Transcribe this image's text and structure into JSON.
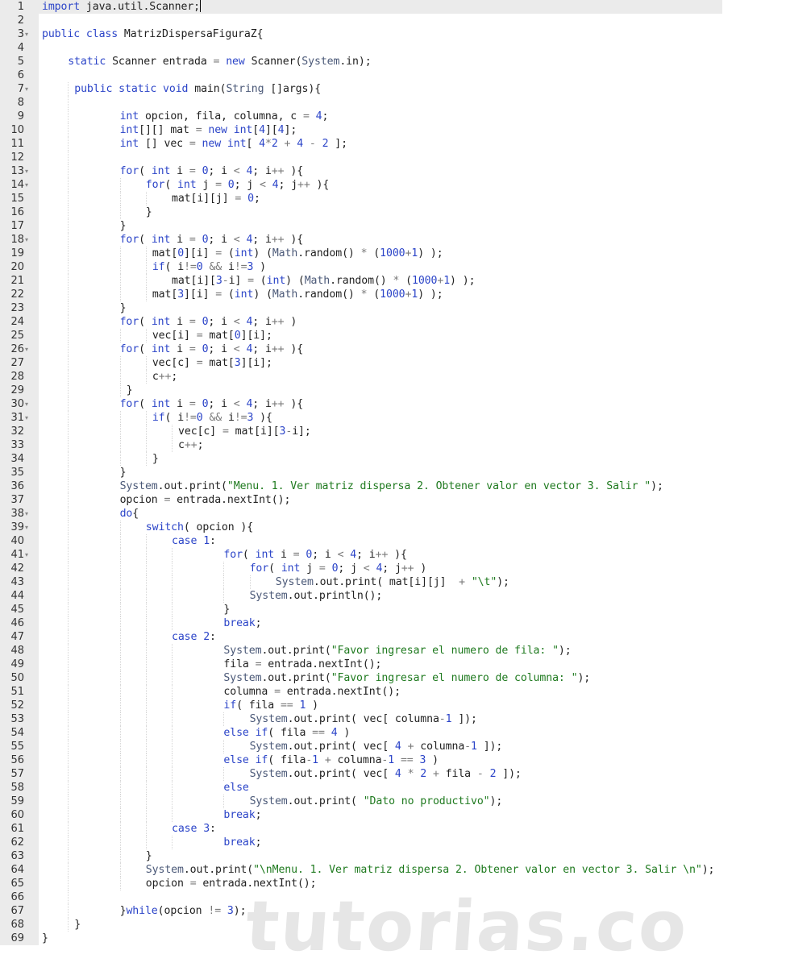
{
  "editor": {
    "language": "java",
    "active_line": 1,
    "cursor_line": 1,
    "lines": [
      {
        "n": "1",
        "indent": 0,
        "text": "import java.util.Scanner;"
      },
      {
        "n": "2",
        "indent": 0,
        "text": ""
      },
      {
        "n": "3",
        "indent": 0,
        "fold": true,
        "text": "public class MatrizDispersaFiguraZ{"
      },
      {
        "n": "4",
        "indent": 0,
        "text": ""
      },
      {
        "n": "5",
        "indent": 4,
        "text": "static Scanner entrada = new Scanner(System.in);"
      },
      {
        "n": "6",
        "indent": 0,
        "text": ""
      },
      {
        "n": "7",
        "indent": 5,
        "fold": true,
        "text": "public static void main(String []args){"
      },
      {
        "n": "8",
        "indent": 0,
        "text": ""
      },
      {
        "n": "9",
        "indent": 12,
        "text": "int opcion, fila, columna, c = 4;"
      },
      {
        "n": "10",
        "indent": 12,
        "text": "int[][] mat = new int[4][4];"
      },
      {
        "n": "11",
        "indent": 12,
        "text": "int [] vec = new int[ 4*2 + 4 - 2 ];"
      },
      {
        "n": "12",
        "indent": 0,
        "text": ""
      },
      {
        "n": "13",
        "indent": 12,
        "fold": true,
        "text": "for( int i = 0; i < 4; i++ ){"
      },
      {
        "n": "14",
        "indent": 16,
        "fold": true,
        "text": "for( int j = 0; j < 4; j++ ){"
      },
      {
        "n": "15",
        "indent": 20,
        "text": "mat[i][j] = 0;"
      },
      {
        "n": "16",
        "indent": 16,
        "text": "}"
      },
      {
        "n": "17",
        "indent": 12,
        "text": "}"
      },
      {
        "n": "18",
        "indent": 12,
        "fold": true,
        "text": "for( int i = 0; i < 4; i++ ){"
      },
      {
        "n": "19",
        "indent": 17,
        "text": "mat[0][i] = (int) (Math.random() * (1000+1) );"
      },
      {
        "n": "20",
        "indent": 17,
        "text": "if( i!=0 && i!=3 )"
      },
      {
        "n": "21",
        "indent": 20,
        "text": "mat[i][3-i] = (int) (Math.random() * (1000+1) );"
      },
      {
        "n": "22",
        "indent": 17,
        "text": "mat[3][i] = (int) (Math.random() * (1000+1) );"
      },
      {
        "n": "23",
        "indent": 12,
        "text": "}"
      },
      {
        "n": "24",
        "indent": 12,
        "text": "for( int i = 0; i < 4; i++ )"
      },
      {
        "n": "25",
        "indent": 17,
        "text": "vec[i] = mat[0][i];"
      },
      {
        "n": "26",
        "indent": 12,
        "fold": true,
        "text": "for( int i = 0; i < 4; i++ ){"
      },
      {
        "n": "27",
        "indent": 17,
        "text": "vec[c] = mat[3][i];"
      },
      {
        "n": "28",
        "indent": 17,
        "text": "c++;"
      },
      {
        "n": "29",
        "indent": 13,
        "text": "}"
      },
      {
        "n": "30",
        "indent": 12,
        "fold": true,
        "text": "for( int i = 0; i < 4; i++ ){"
      },
      {
        "n": "31",
        "indent": 17,
        "fold": true,
        "text": "if( i!=0 && i!=3 ){"
      },
      {
        "n": "32",
        "indent": 21,
        "text": "vec[c] = mat[i][3-i];"
      },
      {
        "n": "33",
        "indent": 21,
        "text": "c++;"
      },
      {
        "n": "34",
        "indent": 17,
        "text": "}"
      },
      {
        "n": "35",
        "indent": 12,
        "text": "}"
      },
      {
        "n": "36",
        "indent": 12,
        "text": "System.out.print(\"Menu. 1. Ver matriz dispersa 2. Obtener valor en vector 3. Salir \");"
      },
      {
        "n": "37",
        "indent": 12,
        "text": "opcion = entrada.nextInt();"
      },
      {
        "n": "38",
        "indent": 12,
        "fold": true,
        "text": "do{"
      },
      {
        "n": "39",
        "indent": 16,
        "fold": true,
        "text": "switch( opcion ){"
      },
      {
        "n": "40",
        "indent": 20,
        "text": "case 1:"
      },
      {
        "n": "41",
        "indent": 28,
        "fold": true,
        "text": "for( int i = 0; i < 4; i++ ){"
      },
      {
        "n": "42",
        "indent": 32,
        "text": "for( int j = 0; j < 4; j++ )"
      },
      {
        "n": "43",
        "indent": 36,
        "text": "System.out.print( mat[i][j]  + \"\\t\");"
      },
      {
        "n": "44",
        "indent": 32,
        "text": "System.out.println();"
      },
      {
        "n": "45",
        "indent": 28,
        "text": "}"
      },
      {
        "n": "46",
        "indent": 28,
        "text": "break;"
      },
      {
        "n": "47",
        "indent": 20,
        "text": "case 2:"
      },
      {
        "n": "48",
        "indent": 28,
        "text": "System.out.print(\"Favor ingresar el numero de fila: \");"
      },
      {
        "n": "49",
        "indent": 28,
        "text": "fila = entrada.nextInt();"
      },
      {
        "n": "50",
        "indent": 28,
        "text": "System.out.print(\"Favor ingresar el numero de columna: \");"
      },
      {
        "n": "51",
        "indent": 28,
        "text": "columna = entrada.nextInt();"
      },
      {
        "n": "52",
        "indent": 28,
        "text": "if( fila == 1 )"
      },
      {
        "n": "53",
        "indent": 32,
        "text": "System.out.print( vec[ columna-1 ]);"
      },
      {
        "n": "54",
        "indent": 28,
        "text": "else if( fila == 4 )"
      },
      {
        "n": "55",
        "indent": 32,
        "text": "System.out.print( vec[ 4 + columna-1 ]);"
      },
      {
        "n": "56",
        "indent": 28,
        "text": "else if( fila-1 + columna-1 == 3 )"
      },
      {
        "n": "57",
        "indent": 32,
        "text": "System.out.print( vec[ 4 * 2 + fila - 2 ]);"
      },
      {
        "n": "58",
        "indent": 28,
        "text": "else"
      },
      {
        "n": "59",
        "indent": 32,
        "text": "System.out.print( \"Dato no productivo\");"
      },
      {
        "n": "60",
        "indent": 28,
        "text": "break;"
      },
      {
        "n": "61",
        "indent": 20,
        "text": "case 3:"
      },
      {
        "n": "62",
        "indent": 28,
        "text": "break;"
      },
      {
        "n": "63",
        "indent": 16,
        "text": "}"
      },
      {
        "n": "64",
        "indent": 16,
        "text": "System.out.print(\"\\nMenu. 1. Ver matriz dispersa 2. Obtener valor en vector 3. Salir \\n\");"
      },
      {
        "n": "65",
        "indent": 16,
        "text": "opcion = entrada.nextInt();"
      },
      {
        "n": "66",
        "indent": 0,
        "text": ""
      },
      {
        "n": "67",
        "indent": 12,
        "text": "}while(opcion != 3);"
      },
      {
        "n": "68",
        "indent": 5,
        "text": "}"
      },
      {
        "n": "69",
        "indent": 0,
        "text": "}"
      }
    ]
  },
  "icons": {
    "fold_marker": "▾"
  },
  "colors": {
    "keyword": "#2b44c8",
    "number": "#2b44c8",
    "string": "#1f7a1f",
    "class_name": "#4a5877",
    "gutter_bg": "#ebebeb",
    "active_line_bg": "#ebebeb"
  },
  "watermark": {
    "text": "tutorias.co"
  }
}
